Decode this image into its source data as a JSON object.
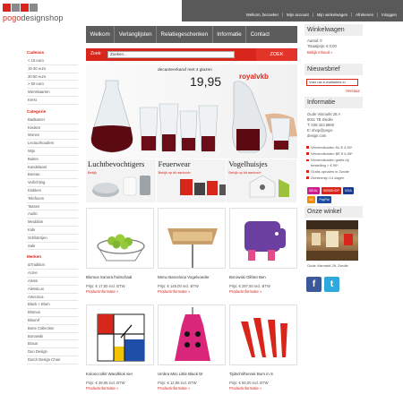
{
  "brand": {
    "name_prefix": "pogo",
    "name_suffix": "designshop",
    "block_colors": [
      "#d9261c",
      "#888888",
      "#d9261c",
      "#888888"
    ]
  },
  "top_links": [
    "Welkom, bezoeker",
    "Mijn account",
    "Mijn winkelwagen",
    "Afrekenen",
    "Inloggen"
  ],
  "nav": [
    "Welkom",
    "Verlanglijsten",
    "Relatiegeschenken",
    "Informatie",
    "Contact"
  ],
  "search": {
    "label": "Zoek:",
    "value": "Zoeken...",
    "button": "ZOEK"
  },
  "sidebar": {
    "cadeaus_title": "Cadeaus",
    "cadeaus": [
      "< 15 euro",
      "15-30 euro",
      "30-50 euro",
      "> 50 euro",
      "Wenskaarten",
      "Kerst"
    ],
    "categorie_title": "Categorie",
    "categorie": [
      "Badkamer",
      "Keuken",
      "Wonen",
      "Lectuurhouders",
      "Wijn",
      "Buiten",
      "Kandelaars",
      "Bureau",
      "Verlichting",
      "Klokken",
      "Telefoons",
      "Tassen",
      "Audio",
      "Meubilair",
      "Kids",
      "Schilderijen",
      "Sale"
    ],
    "merken_title": "Merken",
    "merken": [
      "&Tradition",
      "Acme",
      "Alessi",
      "AlessiLux",
      "Artecnica",
      "Black + Blum",
      "Blomus",
      "Bloomf",
      "Bone Collection",
      "Borowski",
      "Braun",
      "Duo Design",
      "Dutch Design Chair"
    ]
  },
  "cart": {
    "title": "Winkelwagen",
    "count_line": "Aantal: 0",
    "total_line": "Totaalprijs: € 0,00",
    "link": "Bekijk inhoud »"
  },
  "newsletter": {
    "title": "Nieuwsbrief",
    "placeholder": "Voer uw e-mailadres in",
    "send": "Verstuur"
  },
  "info": {
    "title": "Informatie",
    "lines": [
      "Oude Vismarkt 28 A",
      "8011 TB Zwolle",
      "T: 038 423 6880",
      "E: shop@pogo-",
      "design.com"
    ]
  },
  "usp": [
    "Verzendkosten NL € 4,95*",
    "Verzendkosten BE € 6,95*",
    "Verzendkosten gratis bij bestelling > € 50*",
    "Gratis ophalen in Zwolle",
    "Zichtermijn 14 dagen"
  ],
  "payments": [
    {
      "label": "iDEAL",
      "color": "#cc1f8f"
    },
    {
      "label": "WEBSHOP",
      "color": "#d9261c"
    },
    {
      "label": "VISA",
      "color": "#1a3a8f"
    },
    {
      "label": "MC",
      "color": "#f08a00"
    },
    {
      "label": "PayPal",
      "color": "#1b4d9e"
    }
  ],
  "shop": {
    "title": "Onze winkel",
    "caption": "Oude Vismarkt 26, Zwolle"
  },
  "social": [
    {
      "label": "f",
      "color": "#3b5998"
    },
    {
      "label": "t",
      "color": "#2fa8dc"
    }
  ],
  "hero": {
    "caption": "decanteerkaraf met 4 glazen",
    "price": "19,95",
    "brand": "royalvkb"
  },
  "tiles": [
    {
      "title": "Luchtbevochtigers",
      "sub": "Bekijk"
    },
    {
      "title": "Feuerwear",
      "sub": "Bekijk op dit aanbod»"
    },
    {
      "title": "Vogelhuisjes",
      "sub": "Bekijk op dit aanbod»"
    }
  ],
  "products": [
    {
      "name": "Blomus Sonora fruitschaal",
      "price": "Prijs: € 17,50 incl. BTW",
      "info": "Productinformatie »"
    },
    {
      "name": "Menu Barcelona Vogelvoeder",
      "price": "Prijs: € 149,00 incl. BTW",
      "info": "Productinformatie »"
    },
    {
      "name": "Borowski Olifant Ben",
      "price": "Prijs: € 297,50 incl. BTW",
      "info": "Productinformatie »"
    },
    {
      "name": "Koloriccolkit Wandklok vier",
      "price": "Prijs: € 39,95 incl. BTW",
      "info": "Productinformatie »"
    },
    {
      "name": "Umbra Mini Little Black Dr",
      "price": "Prijs: € 12,95 incl. BTW",
      "info": "Productinformatie »"
    },
    {
      "name": "Tijdschriftenrek Born in S",
      "price": "Prijs: € 59,00 incl. BTW",
      "info": "Productinformatie »"
    }
  ]
}
